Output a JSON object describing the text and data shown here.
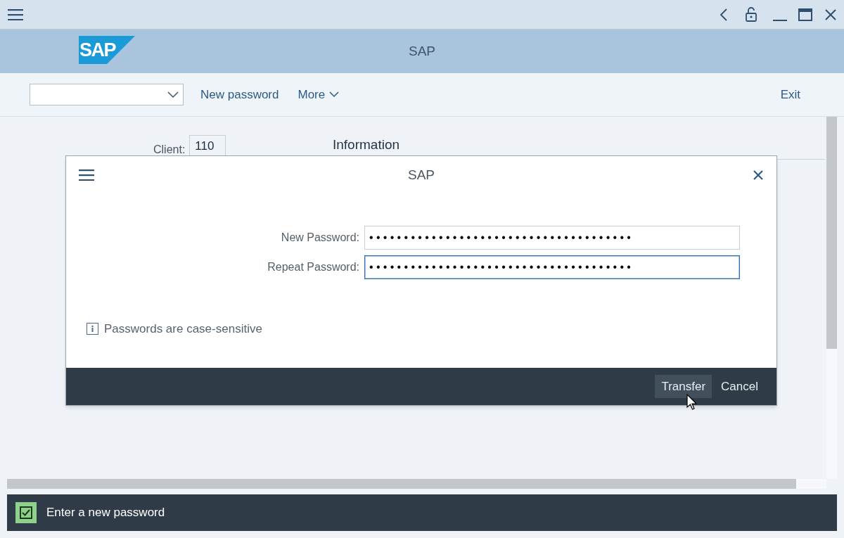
{
  "header": {
    "logo": "SAP",
    "title": "SAP"
  },
  "toolbar": {
    "items": [
      "New password",
      "More"
    ],
    "exit": "Exit"
  },
  "background_form": {
    "client_label": "Client:",
    "client_value": "110",
    "section_title": "Information"
  },
  "dialog": {
    "title": "SAP",
    "fields": [
      {
        "label": "New Password:",
        "value": "••••••••••••••••••••••••••••••••••••••",
        "focused": false
      },
      {
        "label": "Repeat Password:",
        "value": "••••••••••••••••••••••••••••••••••••••",
        "focused": true
      }
    ],
    "info": "Passwords are case-sensitive",
    "buttons": [
      {
        "label": "Transfer",
        "hovered": true
      },
      {
        "label": "Cancel",
        "hovered": false
      }
    ]
  },
  "status_bar": {
    "message": "Enter a new password",
    "checked": true
  }
}
